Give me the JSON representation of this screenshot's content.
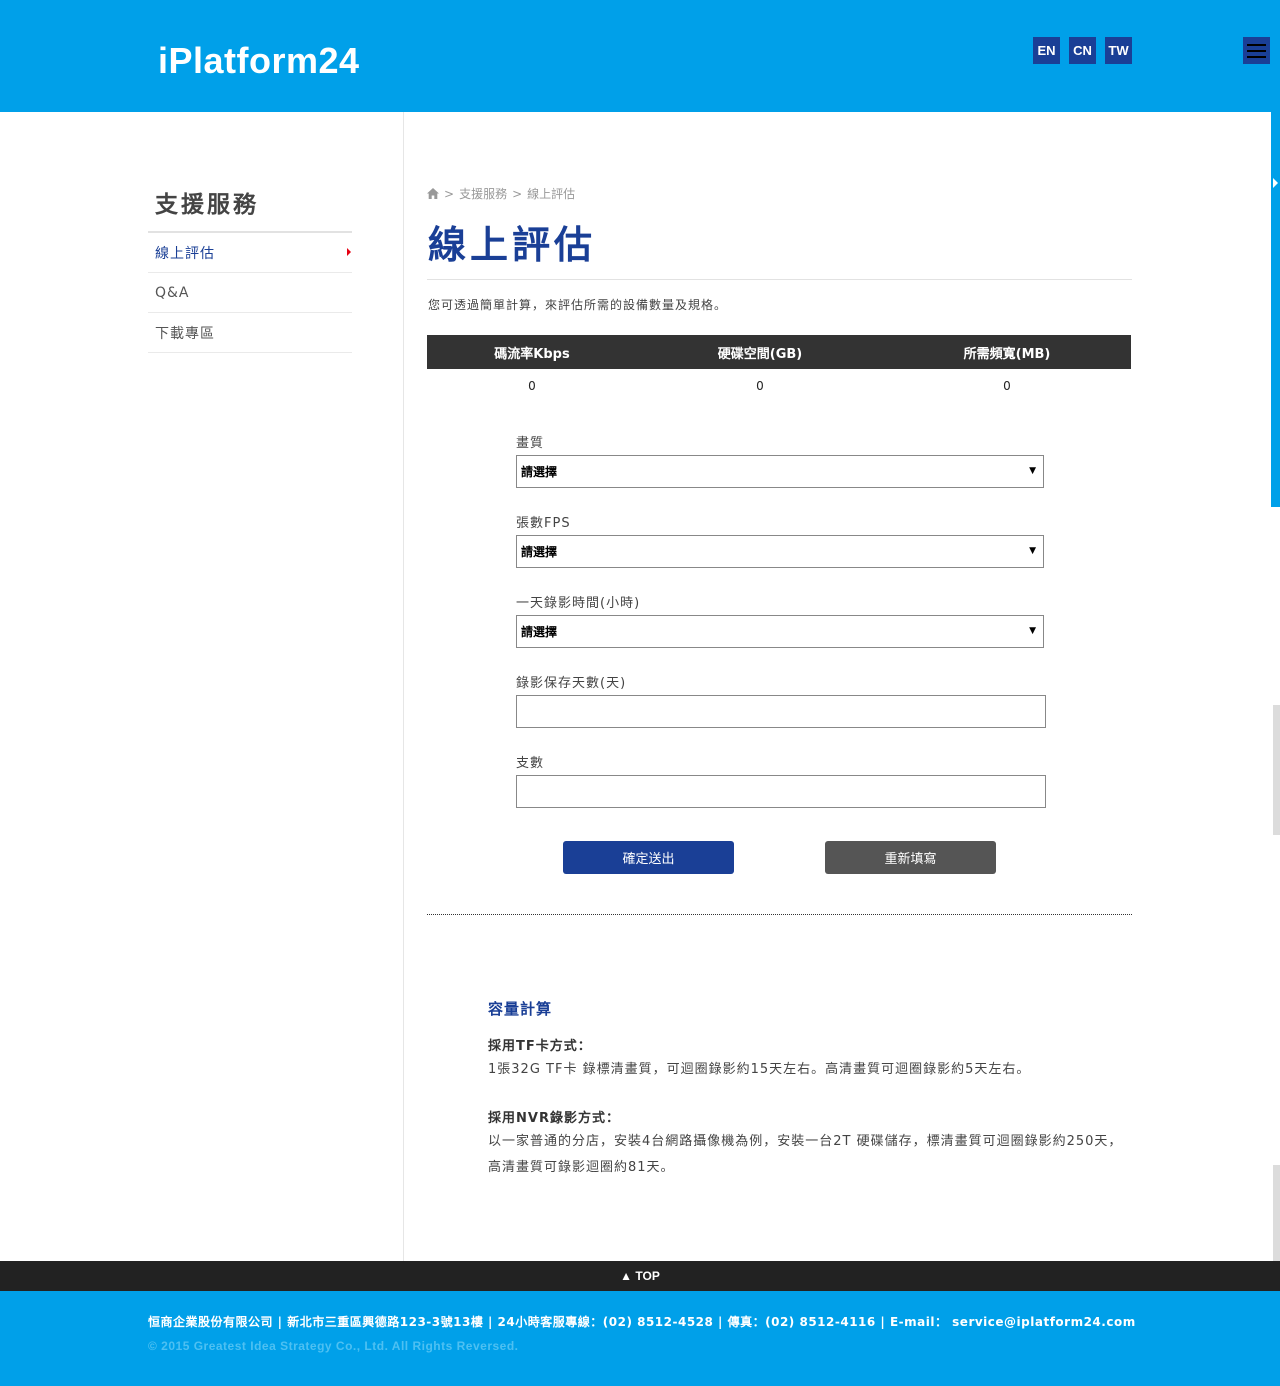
{
  "header": {
    "logo": "iPlatform24",
    "languages": [
      "EN",
      "CN",
      "TW"
    ]
  },
  "sidebar": {
    "title": "支援服務",
    "items": [
      {
        "label": "線上評估",
        "active": true
      },
      {
        "label": "Q&A"
      },
      {
        "label": "下載專區"
      }
    ]
  },
  "breadcrumb": {
    "items": [
      "支援服務",
      "線上評估"
    ],
    "separator": ">"
  },
  "main": {
    "title": "線上評估",
    "intro": "您可透過簡單計算，來評估所需的設備數量及規格。",
    "results": {
      "headers": [
        "碼流率Kbps",
        "硬碟空間(GB)",
        "所需頻寬(MB)"
      ],
      "values": [
        "0",
        "0",
        "0"
      ]
    },
    "form": {
      "quality_label": "畫質",
      "quality_value": "請選擇",
      "fps_label": "張數FPS",
      "fps_value": "請選擇",
      "hours_label": "一天錄影時間(小時)",
      "hours_value": "請選擇",
      "days_label": "錄影保存天數(天)",
      "days_value": "",
      "count_label": "支數",
      "count_value": "",
      "submit_label": "確定送出",
      "reset_label": "重新填寫"
    },
    "capacity": {
      "title": "容量計算",
      "tf_heading": "採用TF卡方式：",
      "tf_text": "1張32G TF卡 錄標清畫質，可迴圈錄影約15天左右。高清畫質可迴圈錄影約5天左右。",
      "nvr_heading": "採用NVR錄影方式：",
      "nvr_text": "以一家普通的分店，安裝4台網路攝像機為例，安裝一台2T 硬碟儲存，標清畫質可迴圈錄影約250天，高清畫質可錄影迴圈約81天。"
    }
  },
  "footer": {
    "top_label": "▲ TOP",
    "info": "恒商企業股份有限公司 | 新北市三重區興德路123-3號13樓 | 24小時客服專線：(02) 8512-4528 | 傳真：(02) 8512-4116 | E-mail： service@iplatform24.com",
    "copyright": "© 2015 Greatest Idea Strategy Co., Ltd. All Rights Reversed."
  },
  "colors": {
    "header_blue": "#00a0e9",
    "brand_dark_blue": "#1a3f96",
    "table_header": "#333333",
    "reset_button": "#555555",
    "active_caret": "#e60012"
  },
  "icons": {
    "home": "home-icon",
    "menu": "hamburger-menu-icon",
    "caret": "caret-right-icon",
    "select_arrow": "triangle-down-icon"
  }
}
